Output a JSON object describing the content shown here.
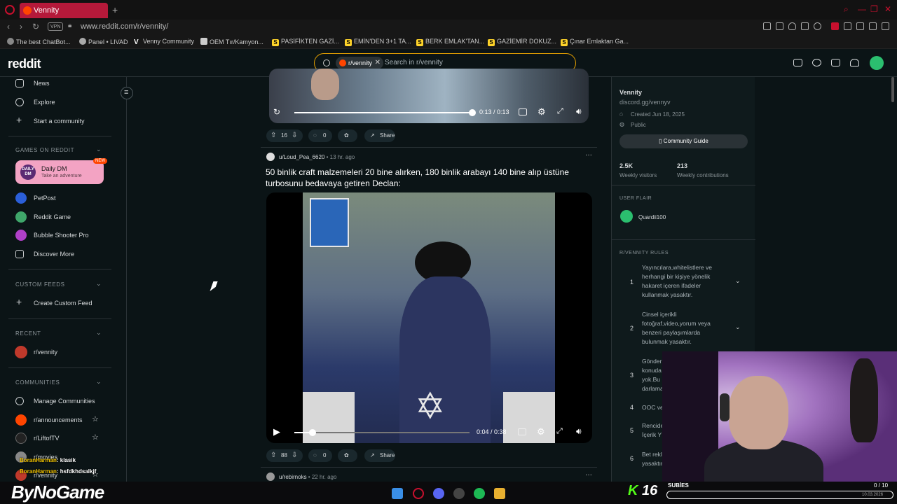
{
  "browser": {
    "tab_title": "Vennity",
    "new_tab": "+",
    "url": "www.reddit.com/r/vennity/",
    "vpn": "VPN",
    "window_controls": [
      "search-icon",
      "minimize-icon",
      "restore-icon",
      "close-icon"
    ],
    "bookmarks": [
      {
        "label": "The best ChatBot...",
        "icon": "chatbot-icon"
      },
      {
        "label": "Panel • LIVAD",
        "icon": "panel-icon"
      },
      {
        "label": "Venny Community",
        "icon": "v-icon"
      },
      {
        "label": "OEM Tır/Kamyon...",
        "icon": "oem-icon"
      },
      {
        "label": "PASİFİKTEN GAZİ...",
        "icon": "s-icon"
      },
      {
        "label": "EMİN'DEN 3+1 TA...",
        "icon": "s-icon"
      },
      {
        "label": "BERK EMLAK'TAN...",
        "icon": "s-icon"
      },
      {
        "label": "GAZİEMİR DOKUZ...",
        "icon": "s-icon"
      },
      {
        "label": "Çınar Emlaktan Ga...",
        "icon": "s-icon"
      }
    ]
  },
  "reddit": {
    "logo": "reddit",
    "search": {
      "chip": "r/vennity",
      "placeholder": "Search in r/vennity"
    }
  },
  "sidebar": {
    "top_items": [
      "News",
      "Explore",
      "Start a community"
    ],
    "games_header": "GAMES ON REDDIT",
    "daily_dm": {
      "logo": "DAILY DM",
      "title": "Daily DM",
      "subtitle": "Take an adventure",
      "badge": "NEW"
    },
    "games": [
      "PetPost",
      "Reddit Game",
      "Bubble Shooter Pro",
      "Discover More"
    ],
    "custom_feeds_header": "CUSTOM FEEDS",
    "create_feed": "Create Custom Feed",
    "recent_header": "RECENT",
    "recent": [
      "r/vennity"
    ],
    "communities_header": "COMMUNITIES",
    "communities": [
      "Manage Communities",
      "r/announcements",
      "r/LiftofTV",
      "r/movies",
      "r/vennity"
    ]
  },
  "feed": {
    "video1": {
      "time": "0:13 / 0:13",
      "progress": 1.0
    },
    "post1_actions": {
      "votes": "16",
      "comments": "0",
      "share": "Share"
    },
    "post2": {
      "author": "u/Loud_Pea_6620",
      "age": "13 hr. ago",
      "title": "50 binlik craft malzemeleri 20 bine alırken, 180 binlik arabayı 140 bine alıp üstüne turbosunu bedavaya getiren Declan:",
      "time": "0:04 / 0:38",
      "progress": 0.105,
      "votes": "88",
      "comments": "0",
      "share": "Share"
    },
    "post3": {
      "author": "u/rebirnoks",
      "age": "22 hr. ago"
    }
  },
  "right": {
    "name": "Vennity",
    "link": "discord.gg/vennyv",
    "created": "Created Jun 18, 2025",
    "public": "Public",
    "guide": "Community Guide",
    "visitors": "2.5K",
    "visitors_label": "Weekly visitors",
    "contributions": "213",
    "contributions_label": "Weekly contributions",
    "flair_header": "USER FLAIR",
    "flair_user": "Quardii100",
    "rules_header": "R/VENNITY RULES",
    "rules": [
      {
        "n": "1",
        "text": "Yayıncılara,whitelistlere ve herhangi bir kişiye yönelik hakaret içeren ifadeler kullanmak yasaktır."
      },
      {
        "n": "2",
        "text": "Cinsel içerikli fotoğraf,video,yorum veya benzeri paylaşımlarda bulunmak yasaktır."
      },
      {
        "n": "3",
        "text": "Gönder konuda yok.Bu darlama"
      },
      {
        "n": "4",
        "text": "OOC ve"
      },
      {
        "n": "5",
        "text": "Rencide İçerik Y"
      },
      {
        "n": "6",
        "text": "Bet rekl yasaktır"
      }
    ]
  },
  "overlay": {
    "chat": [
      {
        "user": "BoranHarman",
        "msg": ": klasik"
      },
      {
        "user": "BoranHarman",
        "msg": ": hsfdkhdsalkjf"
      }
    ],
    "brand": "ByNoGame",
    "kick": "K",
    "kick_n": "16",
    "subs_label": "SUBİES",
    "sub_count": "0 / 10",
    "date": "10.03.2026"
  }
}
